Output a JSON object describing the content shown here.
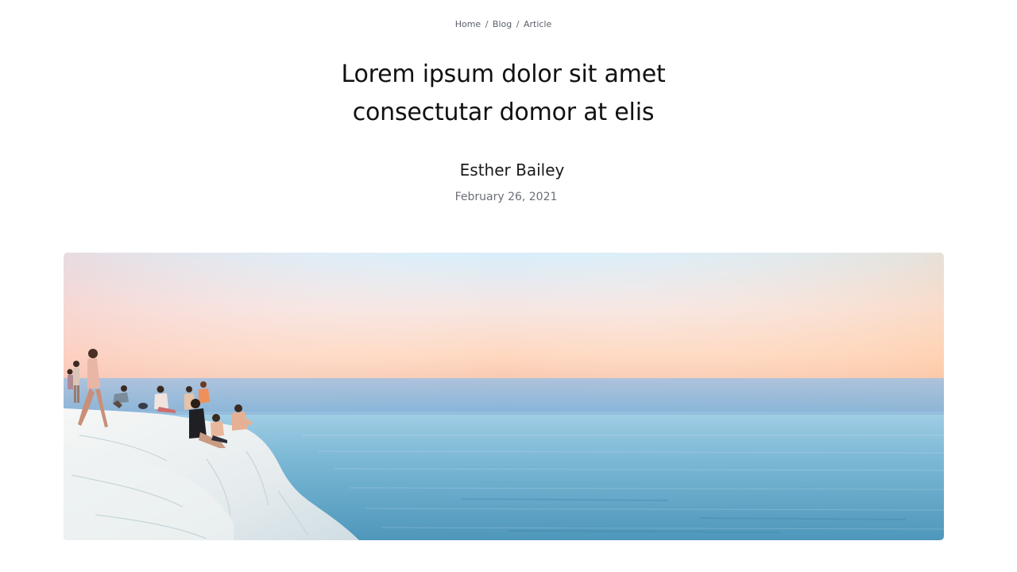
{
  "breadcrumb": {
    "items": [
      "Home",
      "Blog",
      "Article"
    ],
    "separator": "/"
  },
  "article": {
    "title_line1": "Lorem ipsum dolor sit amet",
    "title_line2": "consectutar domor at elis",
    "author": "Esther Bailey",
    "date": "February 26, 2021"
  },
  "hero": {
    "image_name": "hero-image"
  },
  "colors": {
    "text_primary": "#111111",
    "text_muted": "#6b6f76",
    "sky_top": "#dcefff",
    "sky_bottom": "#ffd6b8",
    "sea": "#5a9fc0",
    "rock": "#eef1f2"
  }
}
